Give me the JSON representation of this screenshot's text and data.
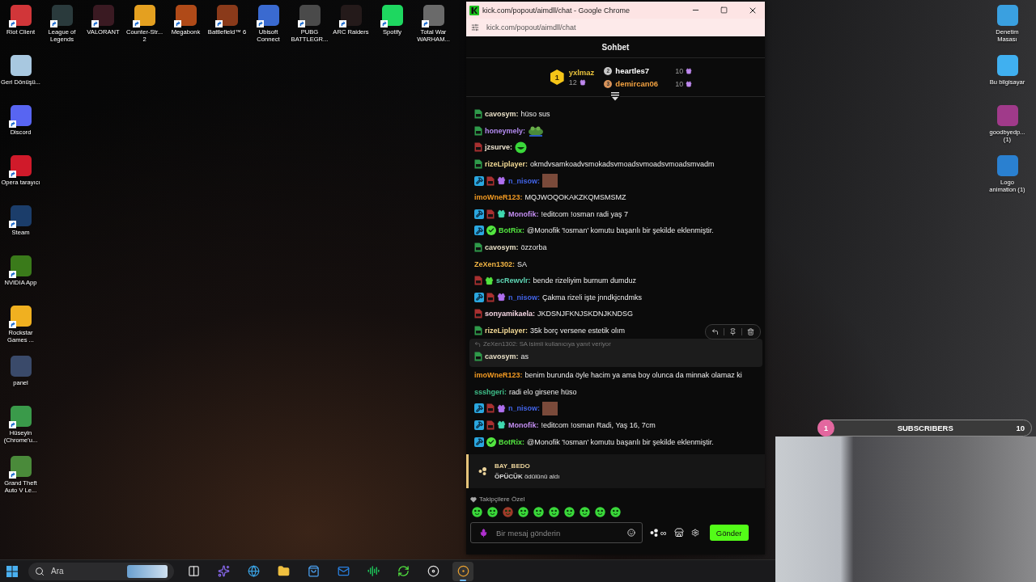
{
  "desktop": {
    "top_row": [
      {
        "label": "Riot Client",
        "color": "#d13639",
        "shortcut": true
      },
      {
        "label": "League of Legends",
        "color": "#2a3a3c",
        "shortcut": true
      },
      {
        "label": "VALORANT",
        "color": "#3a1a22",
        "shortcut": true
      },
      {
        "label": "Counter-Str... 2",
        "color": "#e4a020",
        "shortcut": true
      },
      {
        "label": "Megabonk",
        "color": "#b04a18",
        "shortcut": true
      },
      {
        "label": "Battlefield™ 6",
        "color": "#8a3a1a",
        "shortcut": true
      },
      {
        "label": "Ubisoft Connect",
        "color": "#3a6ad0",
        "shortcut": true
      },
      {
        "label": "PUBG BATTLEGR...",
        "color": "#4a4a4a",
        "shortcut": true
      },
      {
        "label": "ARC Raiders",
        "color": "#241a1a",
        "shortcut": true
      },
      {
        "label": "Spotify",
        "color": "#1ed760",
        "shortcut": true
      },
      {
        "label": "Total War WARHAM...",
        "color": "#6a6a6a",
        "shortcut": true
      }
    ],
    "left_column": [
      {
        "label": "Geri Dönüşü...",
        "color": "#a8c8e0",
        "shortcut": false
      },
      {
        "label": "Discord",
        "color": "#5865f2",
        "shortcut": true
      },
      {
        "label": "Opera tarayıcı",
        "color": "#d01a2a",
        "shortcut": true
      },
      {
        "label": "Steam",
        "color": "#1b3d6a",
        "shortcut": true
      },
      {
        "label": "NVIDIA App",
        "color": "#3a7a1a",
        "shortcut": true
      },
      {
        "label": "Rockstar Games ...",
        "color": "#f0b020",
        "shortcut": true
      },
      {
        "label": "panel",
        "color": "#3a4a6a",
        "shortcut": false
      },
      {
        "label": "Hüseyin (Chrome'u...",
        "color": "#3a9a4a",
        "shortcut": true
      },
      {
        "label": "Grand Theft Auto V Le...",
        "color": "#4a8a3a",
        "shortcut": true
      }
    ],
    "right_column": [
      {
        "label": "Denetim Masası",
        "color": "#3aa0e0",
        "shortcut": false
      },
      {
        "label": "Bu bilgisayar",
        "color": "#40b0f0",
        "shortcut": false
      },
      {
        "label": "goodbyedp... (1)",
        "color": "#a03a8a",
        "shortcut": false
      },
      {
        "label": "Logo animation (1)",
        "color": "#2a80d0",
        "shortcut": false
      }
    ]
  },
  "browser": {
    "title": "kick.com/popout/aimdll/chat - Google Chrome",
    "url": "kick.com/popout/aimdll/chat"
  },
  "chat": {
    "title": "Sohbet",
    "leaderboard": {
      "top": {
        "rank": "1",
        "name": "yxlmaz",
        "count": "12",
        "color": "#e8c23c"
      },
      "runners_up": [
        {
          "rank": "2",
          "name": "heartles7",
          "count": "10",
          "color": "#ffffff"
        },
        {
          "rank": "3",
          "name": "demircan06",
          "count": "10",
          "color": "#f0a040"
        }
      ]
    },
    "messages": [
      {
        "kind": "chat",
        "badges": [
          {
            "kind": "sub",
            "color": "#2f9a4a"
          }
        ],
        "user": "cavosym:",
        "color": "#e8dfc6",
        "text": "hüso sus",
        "hovered": false
      },
      {
        "kind": "chat",
        "badges": [
          {
            "kind": "sub",
            "color": "#2f9a4a"
          }
        ],
        "user": "honeymely:",
        "color": "#b48cf2",
        "emote": {
          "kind": "frog"
        },
        "hovered": false
      },
      {
        "kind": "chat",
        "badges": [
          {
            "kind": "sub",
            "color": "#a83030"
          }
        ],
        "user": "jzsurve:",
        "color": "#efe6d2",
        "emote": {
          "kind": "laugh"
        },
        "hovered": false
      },
      {
        "kind": "chat",
        "badges": [
          {
            "kind": "sub",
            "color": "#2f9a4a"
          }
        ],
        "user": "rizeLiplayer:",
        "color": "#f1d894",
        "text": "okmdvsamkoadvsmokadsvmoadsvmoadsvmoadsmvadm",
        "hovered": false
      },
      {
        "kind": "chat",
        "badges": [
          {
            "kind": "moderator"
          },
          {
            "kind": "sub",
            "color": "#a83030"
          },
          {
            "kind": "gifter",
            "color": "#b070f0"
          }
        ],
        "user": "n_nisow:",
        "color": "#4264e8",
        "emote": {
          "kind": "photo"
        },
        "hovered": false
      },
      {
        "kind": "chat",
        "user": "imoWneR123:",
        "color": "#f39a22",
        "text": "MQJWOQOKAKZKQMSMSMZ",
        "hovered": false
      },
      {
        "kind": "chat",
        "badges": [
          {
            "kind": "moderator"
          },
          {
            "kind": "sub",
            "color": "#a83030"
          },
          {
            "kind": "gifter",
            "color": "#40d8b0"
          }
        ],
        "user": "Monofik:",
        "color": "#c48ef2",
        "text": "!editcom !osman radi yaş 7",
        "hovered": false
      },
      {
        "kind": "chat",
        "badges": [
          {
            "kind": "moderator"
          },
          {
            "kind": "verified"
          }
        ],
        "user": "BotRix:",
        "color": "#53e640",
        "text": "@Monofik '!osman' komutu başarılı bir şekilde eklenmiştir.",
        "hovered": false
      },
      {
        "kind": "chat",
        "badges": [
          {
            "kind": "sub",
            "color": "#2f9a4a"
          }
        ],
        "user": "cavosym:",
        "color": "#e8dfc6",
        "text": "özzorba",
        "hovered": false
      },
      {
        "kind": "chat",
        "user": "ZeXen1302:",
        "color": "#f2b544",
        "text": "SA",
        "hovered": false
      },
      {
        "kind": "chat",
        "badges": [
          {
            "kind": "sub",
            "color": "#a83030"
          },
          {
            "kind": "gifter",
            "color": "#53e640"
          }
        ],
        "user": "scRewvlr:",
        "color": "#5fd6b5",
        "text": "bende rizeliyim burnum dumduz",
        "hovered": false
      },
      {
        "kind": "chat",
        "badges": [
          {
            "kind": "moderator"
          },
          {
            "kind": "sub",
            "color": "#a83030"
          },
          {
            "kind": "gifter",
            "color": "#b070f0"
          }
        ],
        "user": "n_nisow:",
        "color": "#4264e8",
        "text": "Çakma rizeli işte jnndkjcndmks",
        "hovered": false
      },
      {
        "kind": "chat",
        "badges": [
          {
            "kind": "sub",
            "color": "#a83030"
          }
        ],
        "user": "sonyamikaela:",
        "color": "#f1d3df",
        "text": "JKDSNJFKNJSKDNJKNDSG",
        "hovered": false
      },
      {
        "kind": "chat",
        "badges": [
          {
            "kind": "sub",
            "color": "#2f9a4a"
          }
        ],
        "user": "rizeLiplayer:",
        "color": "#f1d894",
        "text": "35k borç versene estetik olım",
        "hovered": false
      },
      {
        "kind": "reply",
        "reply_to": "ZeXen1302: SA isimli kullanıcıya yanıt veriyor",
        "badges": [
          {
            "kind": "sub",
            "color": "#2f9a4a"
          }
        ],
        "user": "cavosym:",
        "color": "#e8dfc6",
        "text": "as",
        "hovered": true
      },
      {
        "kind": "chat",
        "user": "imoWneR123:",
        "color": "#f39a22",
        "text": "benim burunda öyle hacim ya ama boy olunca da minnak olamaz ki",
        "hovered": false
      },
      {
        "kind": "chat",
        "user": "ssshgeri:",
        "color": "#3fbf8a",
        "text": "radi elo girsene hüso",
        "hovered": false
      },
      {
        "kind": "chat",
        "badges": [
          {
            "kind": "moderator"
          },
          {
            "kind": "sub",
            "color": "#a83030"
          },
          {
            "kind": "gifter",
            "color": "#b070f0"
          }
        ],
        "user": "n_nisow:",
        "color": "#4264e8",
        "emote": {
          "kind": "photo"
        },
        "hovered": false
      },
      {
        "kind": "chat",
        "badges": [
          {
            "kind": "moderator"
          },
          {
            "kind": "sub",
            "color": "#a83030"
          },
          {
            "kind": "gifter",
            "color": "#40d8b0"
          }
        ],
        "user": "Monofik:",
        "color": "#c48ef2",
        "text": "!editcom !osman Radi, Yaş 16, 7cm",
        "hovered": false
      },
      {
        "kind": "chat",
        "badges": [
          {
            "kind": "moderator"
          },
          {
            "kind": "verified"
          }
        ],
        "user": "BotRix:",
        "color": "#53e640",
        "text": "@Monofik '!osman' komutu başarılı bir şekilde eklenmiştir.",
        "hovered": false
      }
    ],
    "reward": {
      "user": "BAY_BEDO",
      "text": "**ÖPÜCÜK** ödülünü aldı"
    },
    "emote_section": "Takipçilere Özel",
    "input": {
      "placeholder": "Bir mesaj gönderin",
      "points": "∞",
      "send": "Gönder"
    }
  },
  "subscriber_goal": {
    "current": "1",
    "label": "SUBSCRIBERS",
    "goal": "10"
  },
  "taskbar": {
    "search_placeholder": "Ara",
    "apps": [
      {
        "kind": "taskview",
        "active": false
      },
      {
        "kind": "copilot",
        "active": false
      },
      {
        "kind": "edge",
        "active": false
      },
      {
        "kind": "explorer",
        "active": false
      },
      {
        "kind": "store",
        "active": false
      },
      {
        "kind": "outlook",
        "active": false
      },
      {
        "kind": "spotify",
        "active": false
      },
      {
        "kind": "refresh",
        "active": false
      },
      {
        "kind": "obs",
        "active": false
      },
      {
        "kind": "chrome",
        "active": true
      }
    ]
  }
}
